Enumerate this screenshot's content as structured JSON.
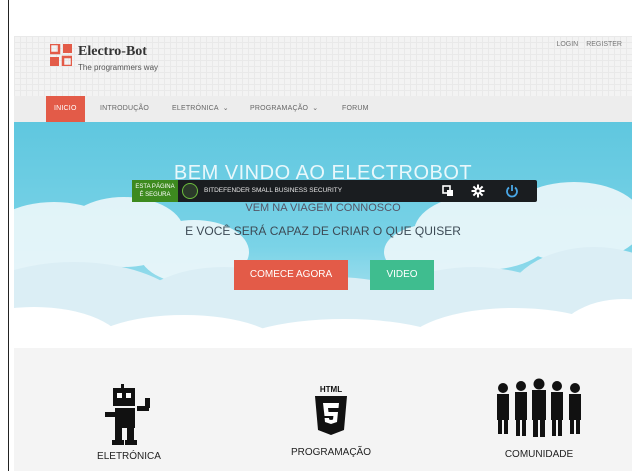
{
  "brand": {
    "name": "Electro-Bot",
    "tagline": "The programmers way",
    "accent": "#e35b48",
    "logo_icon": "logo-icon"
  },
  "top_links": {
    "login": "LOGIN",
    "register": "REGISTER"
  },
  "nav": {
    "items": [
      {
        "label": "INICIO",
        "active": true
      },
      {
        "label": "INTRODUÇÃO"
      },
      {
        "label": "ELETRÓNICA",
        "dropdown": true
      },
      {
        "label": "PROGRAMAÇÃO",
        "dropdown": true
      },
      {
        "label": "FORUM"
      }
    ]
  },
  "hero": {
    "title": "BEM VINDO AO ELECTROBOT",
    "line2": "VEM NA VIAGEM CONNOSCO",
    "subtitle": "E VOCÊ SERÁ CAPAZ DE CRIAR O QUE QUISER",
    "primary_button": "COMECE AGORA",
    "secondary_button": "VIDEO",
    "colors": {
      "sky": "#5fc7df",
      "primary": "#e35b48",
      "secondary": "#3fbd8f"
    }
  },
  "security_toolbar": {
    "badge_line1": "ESTA PÁGINA",
    "badge_line2": "É SEGURA",
    "label": "BITDEFENDER SMALL BUSINESS SECURITY",
    "icons": [
      "copy-icon",
      "settings-icon",
      "power-icon"
    ]
  },
  "features": [
    {
      "label": "ELETRÓNICA",
      "icon": "robot-icon"
    },
    {
      "label": "PROGRAMAÇÃO",
      "icon": "html5-icon",
      "icon_text": "HTML"
    },
    {
      "label": "COMUNIDADE",
      "icon": "people-icon"
    }
  ]
}
